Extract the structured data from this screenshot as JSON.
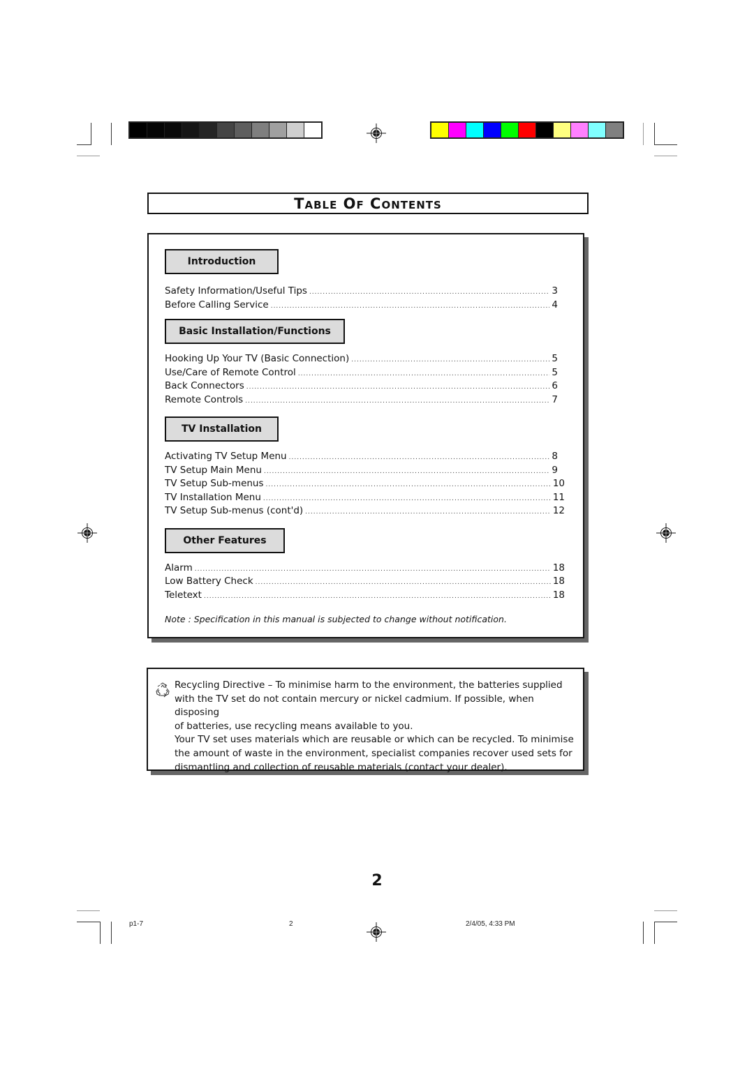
{
  "calibration": {
    "grayscale_swatches": [
      "#000000",
      "#050505",
      "#0a0a0a",
      "#151515",
      "#252525",
      "#454545",
      "#5e5e5e",
      "#7f7f7f",
      "#a0a0a0",
      "#cfcfcf",
      "#ffffff"
    ],
    "color_swatches": [
      "#ffff00",
      "#ff00ff",
      "#00ffff",
      "#0000ff",
      "#00ff00",
      "#ff0000",
      "#000000",
      "#ffff80",
      "#ff80ff",
      "#80ffff",
      "#808080"
    ]
  },
  "title": "Table Of Contents",
  "sections": [
    {
      "heading": "Introduction",
      "entries": [
        {
          "label": "Safety Information/Useful Tips",
          "page": "3"
        },
        {
          "label": "Before Calling Service",
          "page": "4"
        }
      ]
    },
    {
      "heading": "Basic Installation/Functions",
      "entries": [
        {
          "label": "Hooking Up Your TV (Basic Connection)",
          "page": "5"
        },
        {
          "label": "Use/Care of Remote Control",
          "page": "5"
        },
        {
          "label": "Back Connectors",
          "page": "6"
        },
        {
          "label": "Remote Controls",
          "page": "7"
        }
      ]
    },
    {
      "heading": "TV Installation",
      "entries": [
        {
          "label": "Activating TV Setup Menu",
          "page": "8"
        },
        {
          "label": "TV Setup Main Menu",
          "page": "9"
        },
        {
          "label": "TV Setup Sub-menus",
          "page": "10"
        },
        {
          "label": "TV Installation Menu",
          "page": "11"
        },
        {
          "label": "TV Setup Sub-menus (cont'd)",
          "page": "12"
        }
      ]
    },
    {
      "heading": "Other Features",
      "entries": [
        {
          "label": "Alarm",
          "page": "18"
        },
        {
          "label": "Low Battery Check",
          "page": "18"
        },
        {
          "label": "Teletext",
          "page": "18"
        }
      ]
    }
  ],
  "note": "Note : Specification in this manual is subjected to change without notification.",
  "recycling": {
    "icon": "recycle-icon",
    "lines": [
      "Recycling Directive –  To minimise harm to the environment, the batteries supplied",
      "with the TV set do not contain mercury or nickel cadmium.  If possible, when disposing",
      "of batteries, use recycling means available to you.",
      "Your TV set uses materials which are reusable or which can be recycled.  To minimise",
      "the amount of waste in the environment, specialist companies recover used sets for",
      "dismantling and collection of reusable materials (contact your dealer)."
    ]
  },
  "page_number": "2",
  "footer": {
    "file": "p1-7",
    "page": "2",
    "datetime": "2/4/05, 4:33 PM"
  }
}
